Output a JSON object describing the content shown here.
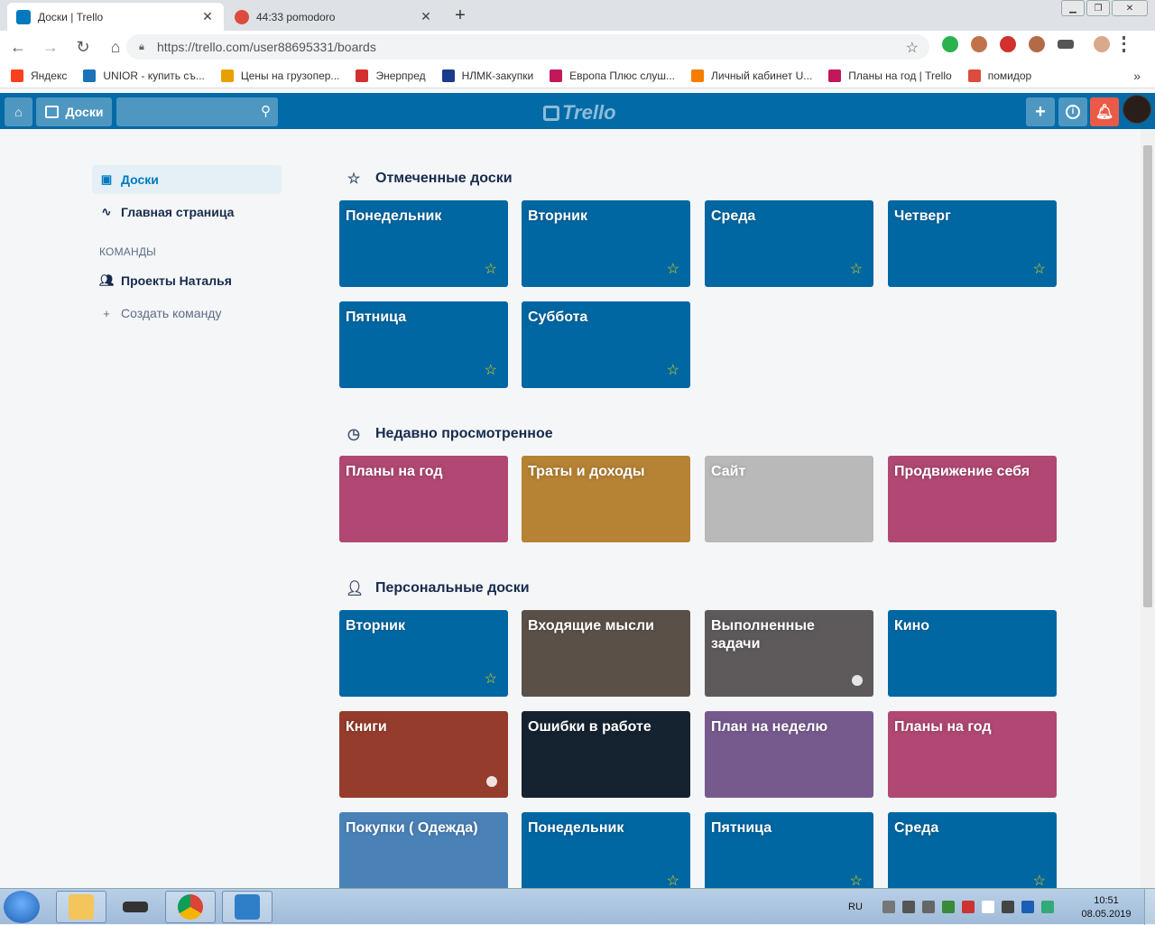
{
  "browser": {
    "tabs": [
      {
        "title": "Доски | Trello",
        "favicon_color": "#0079bf"
      },
      {
        "title": "44:33 pomodoro",
        "favicon_color": "#db4c3f"
      }
    ],
    "url": "https://trello.com/user88695331/boards",
    "bookmarks": [
      {
        "label": "Яндекс",
        "icon": "yandex-icon",
        "color": "#fc3f1d"
      },
      {
        "label": "UNIOR - купить съ...",
        "icon": "unior-icon",
        "color": "#1a73b8"
      },
      {
        "label": "Цены на грузопер...",
        "icon": "cargo-icon",
        "color": "#e8a000"
      },
      {
        "label": "Энерпред",
        "icon": "enerpred-icon",
        "color": "#d32f2f"
      },
      {
        "label": "НЛМК-закупки",
        "icon": "nlmk-icon",
        "color": "#1a3c8c"
      },
      {
        "label": "Европа Плюс слуш...",
        "icon": "europa-icon",
        "color": "#c2185b"
      },
      {
        "label": "Личный кабинет U...",
        "icon": "cabinet-icon",
        "color": "#f57c00"
      },
      {
        "label": "Планы на год | Trello",
        "icon": "trello-bookmark-icon",
        "color": "#c2185b"
      },
      {
        "label": "помидор",
        "icon": "tomato-icon",
        "color": "#db4c3f"
      }
    ],
    "bookmarks_more": "»"
  },
  "header": {
    "boards_label": "Доски",
    "logo_text": "Trello"
  },
  "sidebar": {
    "boards": "Доски",
    "home": "Главная страница",
    "teams_heading": "КОМАНДЫ",
    "team": "Проекты Наталья",
    "create_team": "Создать команду"
  },
  "sections": {
    "starred": {
      "title": "Отмеченные доски",
      "boards": [
        {
          "name": "Понедельник",
          "color": "#0067a3",
          "starred": true
        },
        {
          "name": "Вторник",
          "color": "#0067a3",
          "starred": true
        },
        {
          "name": "Среда",
          "color": "#0067a3",
          "starred": true
        },
        {
          "name": "Четверг",
          "color": "#0067a3",
          "starred": true
        },
        {
          "name": "Пятница",
          "color": "#0067a3",
          "starred": true
        },
        {
          "name": "Суббота",
          "color": "#0067a3",
          "starred": true
        }
      ]
    },
    "recent": {
      "title": "Недавно просмотренное",
      "boards": [
        {
          "name": "Планы на год",
          "color": "#b04873"
        },
        {
          "name": "Траты и доходы",
          "color": "#b68234"
        },
        {
          "name": "Сайт",
          "color": "#b9b9b9"
        },
        {
          "name": "Продвижение себя",
          "color": "#b04873"
        }
      ]
    },
    "personal": {
      "title": "Персональные доски",
      "boards": [
        {
          "name": "Вторник",
          "color": "#0067a3",
          "starred": true
        },
        {
          "name": "Входящие мысли",
          "color": "#5a5048"
        },
        {
          "name": "Выполненные задачи",
          "color": "#5e5a5c",
          "dot": true
        },
        {
          "name": "Кино",
          "color": "#0067a3"
        },
        {
          "name": "Книги",
          "color": "#953c2c",
          "dot": true
        },
        {
          "name": "Ошибки в работе",
          "color": "#152230"
        },
        {
          "name": "План на неделю",
          "color": "#765a8e"
        },
        {
          "name": "Планы на год",
          "color": "#b04873"
        },
        {
          "name": "Покупки ( Одежда)",
          "color": "#4a82b8"
        },
        {
          "name": "Понедельник",
          "color": "#0067a3",
          "starred": true
        },
        {
          "name": "Пятница",
          "color": "#0067a3",
          "starred": true
        },
        {
          "name": "Среда",
          "color": "#0067a3",
          "starred": true
        }
      ]
    }
  },
  "taskbar": {
    "lang": "RU",
    "time": "10:51",
    "date": "08.05.2019"
  }
}
